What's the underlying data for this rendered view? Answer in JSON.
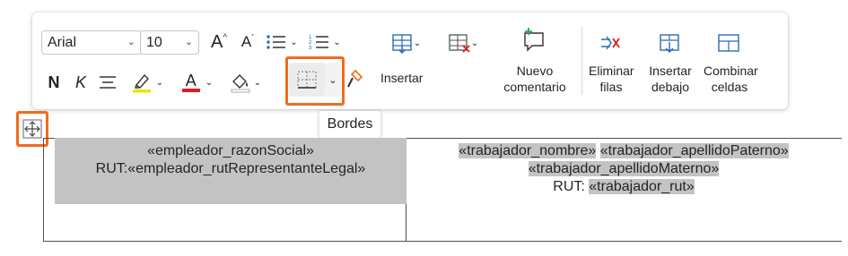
{
  "ribbon": {
    "font_name": "Arial",
    "font_size": "10",
    "bold": "N",
    "italic": "K",
    "font_color_letter": "A",
    "grow_letter": "A",
    "shrink_letter": "A",
    "insert_label": "Insertar",
    "new_comment": [
      "Nuevo",
      "comentario"
    ],
    "delete_rows": [
      "Eliminar",
      "filas"
    ],
    "insert_below": [
      "Insertar",
      "debajo"
    ],
    "merge_cells": [
      "Combinar",
      "celdas"
    ],
    "highlight_color": "#e6e600",
    "font_color": "#e01b1b",
    "accent_orange": "#f26b1d",
    "icon_blue": "#2b6cb0"
  },
  "tooltip": {
    "text": "Bordes"
  },
  "table": {
    "left_cell": {
      "line1": "«empleador_razonSocial»",
      "line2_prefix": "RUT:",
      "line2_field": "«empleador_rutRepresentanteLegal»"
    },
    "right_cell": {
      "field1": "«trabajador_nombre»",
      "field2": "«trabajador_apellidoPaterno»",
      "field3": "«trabajador_apellidoMaterno»",
      "line3_prefix": "RUT: ",
      "field4": "«trabajador_rut»"
    }
  }
}
